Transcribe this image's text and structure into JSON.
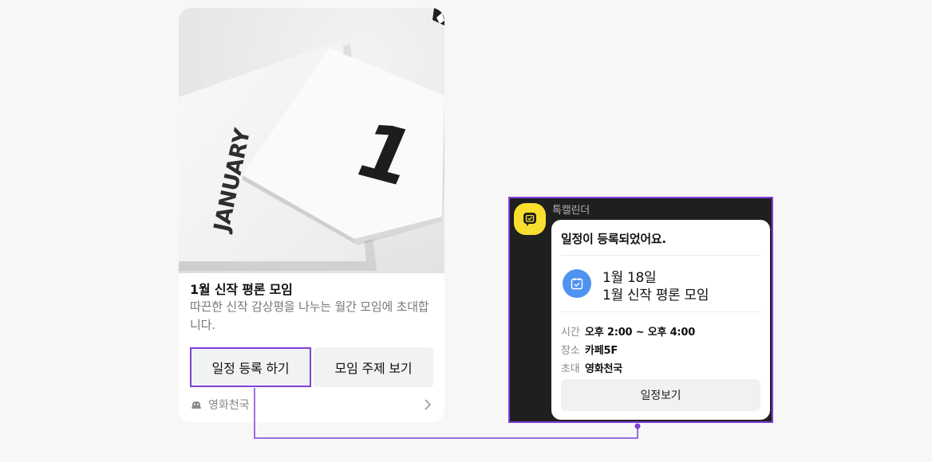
{
  "message_card": {
    "image_alt": "1 JANUARY calendar photo",
    "photo_text": {
      "month": "JANUARY",
      "day": "1"
    },
    "title": "1월 신작 평론 모임",
    "description": "따끈한 신작 감상평을 나누는 월간 모임에 초대합니다.",
    "buttons": {
      "register": "일정 등록 하기",
      "topic": "모임 주제 보기"
    },
    "footer": {
      "channel_name": "영화천국",
      "channel_icon": "channel-profile-icon",
      "chevron_icon": "chevron-right-icon"
    }
  },
  "talk_calendar": {
    "sender": "톡캘린더",
    "avatar_icon": "talk-calendar-icon",
    "heading": "일정이 등록되었어요.",
    "event": {
      "date": "1월 18일",
      "name": "1월 신작 평론 모임",
      "icon": "calendar-check-icon"
    },
    "details": [
      {
        "label": "시간",
        "value": "오후 2:00 ~ 오후 4:00"
      },
      {
        "label": "장소",
        "value": "카페5F"
      },
      {
        "label": "초대",
        "value": "영화천국"
      }
    ],
    "view_button": "일정보기"
  },
  "colors": {
    "page_bg": "#f7f7f7",
    "highlight": "#7d41d9",
    "button_bg": "#f1f2f4",
    "avatar_yellow": "#f8df2f",
    "calendar_blue": "#4f93f0",
    "dark_bg": "#1f1f20"
  }
}
